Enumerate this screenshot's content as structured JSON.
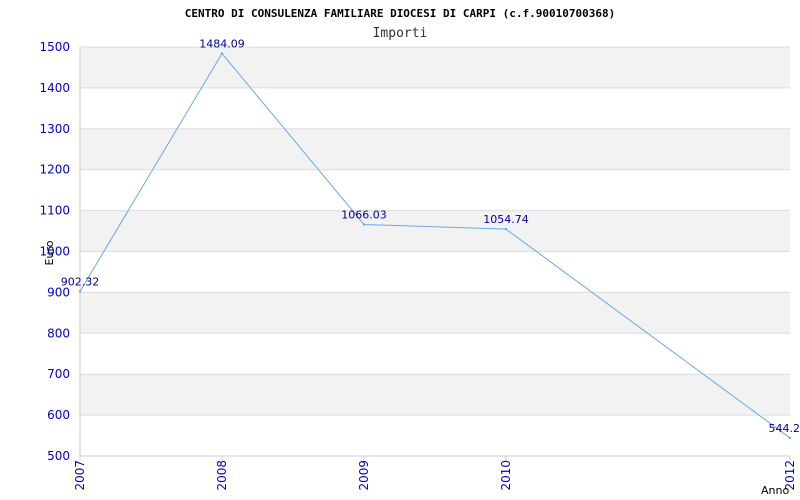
{
  "chart_data": {
    "type": "line",
    "title": "CENTRO DI CONSULENZA FAMILIARE DIOCESI DI CARPI (c.f.90010700368)",
    "subtitle": "Importi",
    "xlabel": "Anno",
    "ylabel": "Euro",
    "categories": [
      "2007",
      "2008",
      "2009",
      "2010",
      "2012"
    ],
    "values": [
      902.32,
      1484.09,
      1066.03,
      1054.74,
      544.2
    ],
    "value_labels": [
      "902.32",
      "1484.09",
      "1066.03",
      "1054.74",
      "544.2"
    ],
    "yticks": [
      "500",
      "600",
      "700",
      "800",
      "900",
      "1000",
      "1100",
      "1200",
      "1300",
      "1400",
      "1500"
    ],
    "ylim": [
      500,
      1500
    ],
    "grid": true,
    "banded_background": true,
    "colors": {
      "line": "#6aa8e8",
      "band": "#f2f2f2",
      "grid": "#dddddd",
      "tick_text": "#0000cc",
      "data_label": "#000099"
    }
  }
}
